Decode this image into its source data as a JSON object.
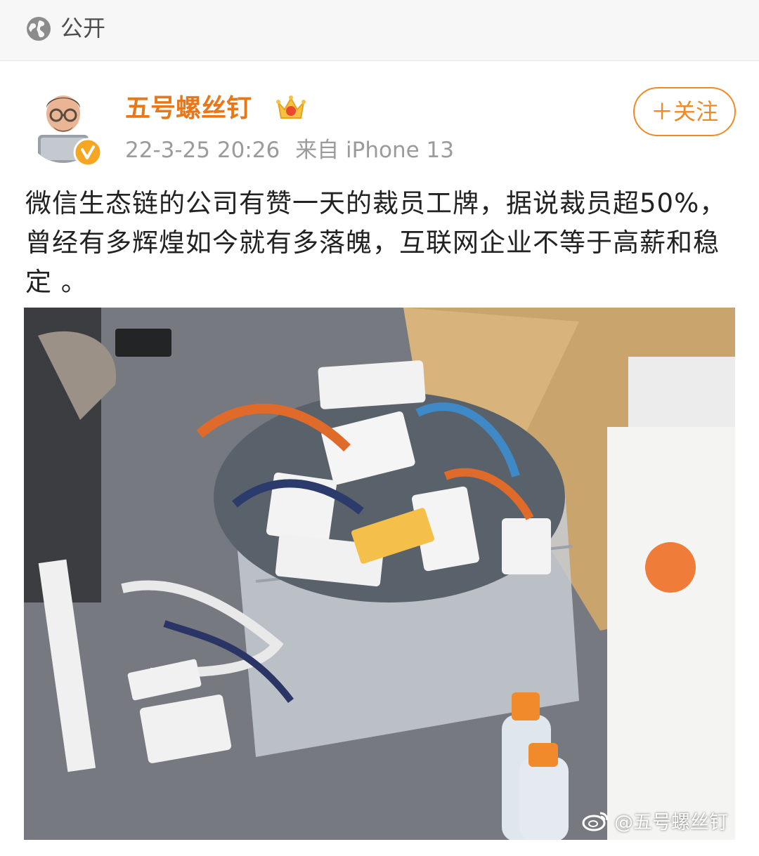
{
  "top_bar": {
    "visibility_icon": "globe-icon",
    "visibility_label": "公开"
  },
  "post": {
    "author": {
      "name": "五号螺丝钉",
      "avatar_icon": "memoji-avatar",
      "verified_icon": "verified-badge-icon",
      "member_icon": "crown-icon"
    },
    "date": "22-3-25 20:26",
    "source": "来自 iPhone 13",
    "follow_label": "＋关注",
    "text": "微信生态链的公司有赞一天的裁员工牌，据说裁员超50%，曾经有多辉煌如今就有多落魄，互联网企业不等于高薪和稳定 。",
    "image": {
      "description_icon": "photo-of-badges-in-box",
      "watermark_icon": "weibo-icon",
      "watermark_text": "@五号螺丝钉"
    }
  },
  "colors": {
    "accent": "#e8771a",
    "follow": "#f08a24",
    "meta": "#9b9b9b",
    "text": "#222222",
    "badge_gold": "#f5a623"
  }
}
